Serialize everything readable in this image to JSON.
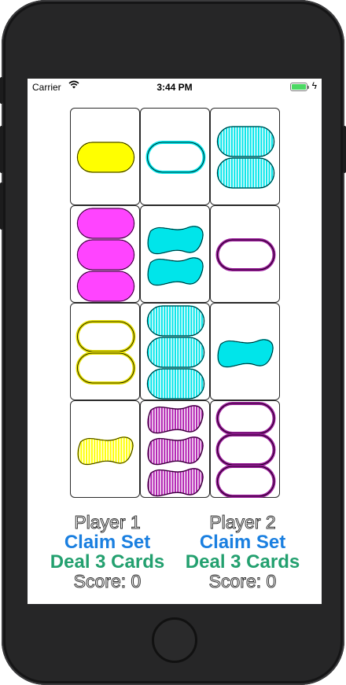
{
  "status_bar": {
    "carrier": "Carrier",
    "time": "3:44 PM"
  },
  "cards": [
    {
      "count": 1,
      "shape": "oval",
      "fill": "solid",
      "color": "#ffff00"
    },
    {
      "count": 1,
      "shape": "oval",
      "fill": "open",
      "color": "#00e5ea"
    },
    {
      "count": 2,
      "shape": "oval",
      "fill": "striped",
      "color": "#00e5ea"
    },
    {
      "count": 3,
      "shape": "oval",
      "fill": "solid",
      "color": "#ff44ff"
    },
    {
      "count": 2,
      "shape": "squiggle",
      "fill": "solid",
      "color": "#00e5ea"
    },
    {
      "count": 1,
      "shape": "oval",
      "fill": "open",
      "color": "#9a189a"
    },
    {
      "count": 2,
      "shape": "oval",
      "fill": "open",
      "color": "#e6e000"
    },
    {
      "count": 3,
      "shape": "oval",
      "fill": "striped",
      "color": "#00e5ea"
    },
    {
      "count": 1,
      "shape": "squiggle",
      "fill": "solid",
      "color": "#00e5ea"
    },
    {
      "count": 1,
      "shape": "squiggle",
      "fill": "striped",
      "color": "#ffff00"
    },
    {
      "count": 3,
      "shape": "squiggle",
      "fill": "striped",
      "color": "#b01cb0"
    },
    {
      "count": 3,
      "shape": "oval",
      "fill": "open",
      "color": "#9a189a"
    }
  ],
  "players": [
    {
      "name": "Player 1",
      "claim_label": "Claim Set",
      "deal_label": "Deal 3 Cards",
      "score_label": "Score: 0"
    },
    {
      "name": "Player 2",
      "claim_label": "Claim Set",
      "deal_label": "Deal 3 Cards",
      "score_label": "Score: 0"
    }
  ],
  "colors": {
    "claim": "#1a7fe0",
    "deal": "#23a06f"
  },
  "icons": [
    "wifi-icon",
    "battery-icon",
    "charging-bolt-icon"
  ]
}
